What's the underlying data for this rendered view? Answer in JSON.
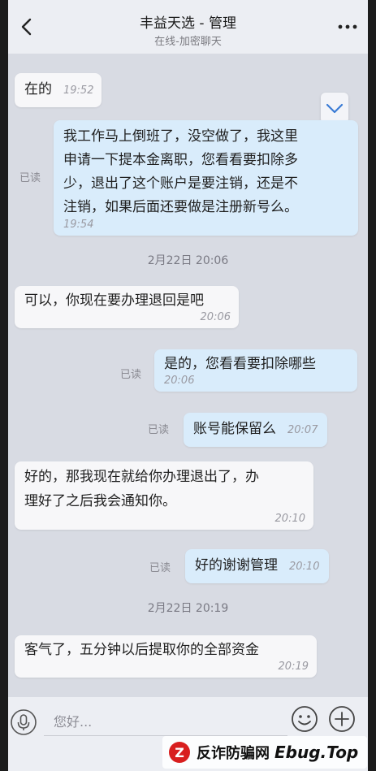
{
  "header": {
    "title": "丰益天选 - 管理",
    "subtitle": "在线-加密聊天"
  },
  "messages": {
    "m1": {
      "text": "在的",
      "time": "19:52"
    },
    "m2": {
      "lines": [
        "我工作马上倒班了，没空做了，我这里",
        "申请一下提本金离职，您看看要扣除多",
        "少，退出了这个账户是要注销，还是不",
        "注销，如果后面还要做是注册新号么。"
      ],
      "time": "19:54",
      "read": "已读"
    },
    "sep1": "2月22日 20:06",
    "m3": {
      "text": "可以，你现在要办理退回是吧",
      "time": "20:06"
    },
    "m4": {
      "text": "是的，您看看要扣除哪些",
      "time": "20:06",
      "read": "已读"
    },
    "m5": {
      "text": "账号能保留么",
      "time": "20:07",
      "read": "已读"
    },
    "m6": {
      "lines": [
        "好的，那我现在就给你办理退出了，办",
        "理好了之后我会通知你。"
      ],
      "time": "20:10"
    },
    "m7": {
      "text": "好的谢谢管理",
      "time": "20:10",
      "read": "已读"
    },
    "sep2": "2月22日 20:19",
    "m8": {
      "text": "客气了，五分钟以后提取你的全部资金",
      "time": "20:19"
    }
  },
  "input": {
    "placeholder": "您好..."
  },
  "watermark": {
    "text": "反诈防骗网",
    "domain": "Ebug.Top"
  },
  "colors": {
    "background": "#d8dbe3",
    "incoming_bubble": "#f7f7f9",
    "outgoing_bubble": "#d9ecfb",
    "watermark_red": "#d81e1e"
  },
  "icons": {
    "back": "chevron-left-icon",
    "more": "more-dots-icon",
    "collapse": "chevron-down-icon",
    "voice": "microphone-icon",
    "emoji": "smiley-icon",
    "plus": "plus-circle-icon"
  }
}
